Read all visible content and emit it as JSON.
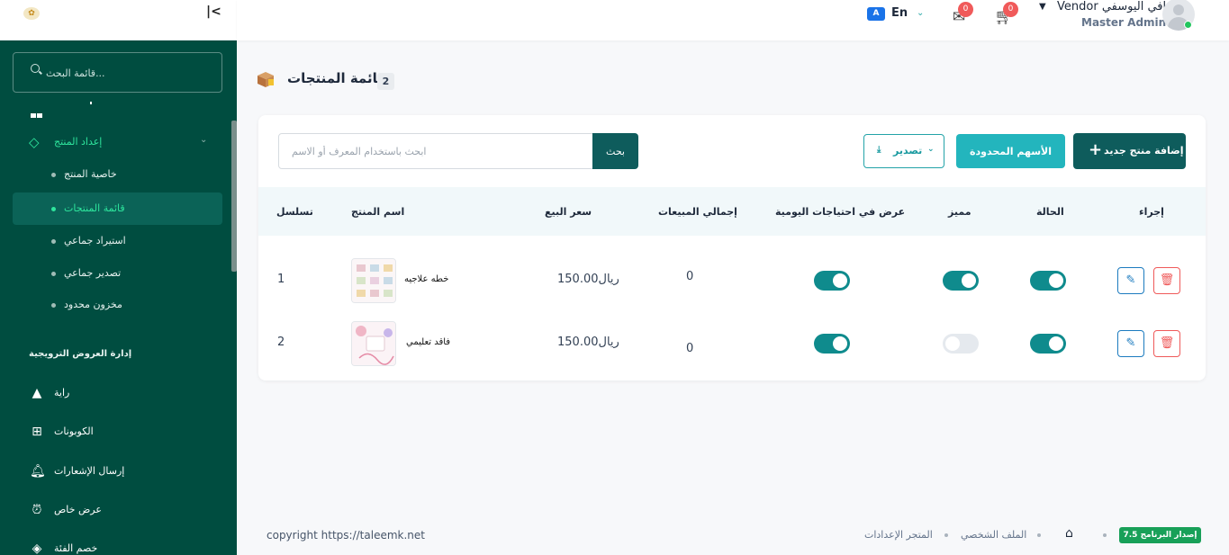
{
  "sidebar": {
    "collapse_icon": "collapse-left-icon",
    "search_placeholder": "قائمة البحث...",
    "group": {
      "label": "إعداد المنتج",
      "icon": "diamond-icon"
    },
    "sub_items": [
      {
        "label": "خاصية المنتج",
        "active": false
      },
      {
        "label": "قائمة المنتجات",
        "active": true
      },
      {
        "label": "استيراد جماعي",
        "active": false
      },
      {
        "label": "تصدير جماعي",
        "active": false
      },
      {
        "label": "مخزون محدود",
        "active": false
      }
    ],
    "section_title": "إدارة العروض الترويجية",
    "items": [
      {
        "label": "راية",
        "icon": "image-icon"
      },
      {
        "label": "الكوبونات",
        "icon": "gift-icon"
      },
      {
        "label": "إرسال الإشعارات",
        "icon": "bell-icon"
      },
      {
        "label": "عرض خاص",
        "icon": "alarm-clock-icon"
      },
      {
        "label": "خصم الفئة",
        "icon": "layers-icon"
      }
    ]
  },
  "header": {
    "language_code": "En",
    "messages_count": "0",
    "cart_count": "0",
    "user_name": "Vendor وافي اليوسفي",
    "user_role": "Master Admin"
  },
  "page": {
    "title": "قائمة المنتجات",
    "count": "2"
  },
  "toolbar": {
    "search_placeholder": "ابحث باستخدام المعرف أو الاسم",
    "search_button": "بحث",
    "export_label": "تصدير",
    "limited_stock_label": "الأسهم المحدودة",
    "add_product_label": "إضافة منتج جديد"
  },
  "table": {
    "columns": [
      "تسلسل",
      "اسم المنتج",
      "سعر البيع",
      "إجمالي المبيعات",
      "عرض في احتياجات اليومية",
      "مميز",
      "الحالة",
      "إجراء"
    ],
    "rows": [
      {
        "serial": "1",
        "name": "خطه علاجيه",
        "price": "150.00ريال",
        "sales": "0",
        "daily_needs": true,
        "featured": true,
        "status": true
      },
      {
        "serial": "2",
        "name": "فاقد تعليمي",
        "price": "150.00ريال",
        "sales": "0",
        "daily_needs": true,
        "featured": false,
        "status": true
      }
    ]
  },
  "footer": {
    "copyright": "copyright https://taleemk.net",
    "breadcrumbs": [
      "المتجر الإعدادات",
      "الملف الشخصي"
    ],
    "version": "إصدار البرنامج 7.5"
  }
}
